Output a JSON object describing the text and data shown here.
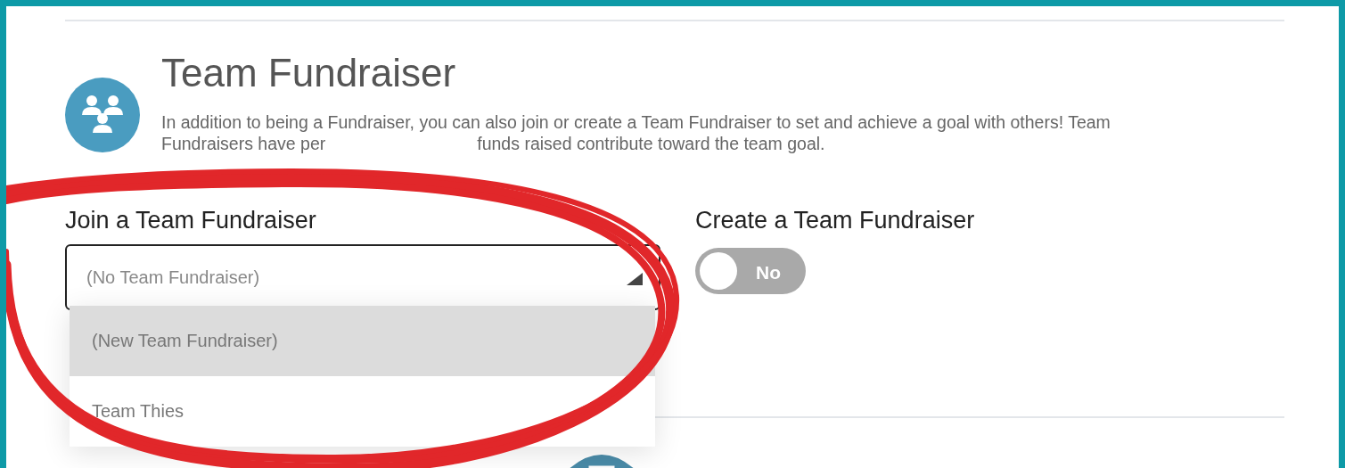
{
  "section": {
    "title": "Team Fundraiser",
    "description_lines": [
      "In addition to being a Fundraiser, you can also join or create a Team Fundraiser to set and achieve a goal with others! Team",
      "Fundraisers have per",
      "funds raised contribute toward the team goal."
    ]
  },
  "join": {
    "label": "Join a Team Fundraiser",
    "value": "(No Team Fundraiser)",
    "expanded": true,
    "options": [
      {
        "label": "(New Team Fundraiser)",
        "selected": true
      },
      {
        "label": "Team Thies",
        "selected": false
      }
    ]
  },
  "create": {
    "label": "Create a Team Fundraiser",
    "toggle": {
      "on": false,
      "label": "No"
    }
  }
}
